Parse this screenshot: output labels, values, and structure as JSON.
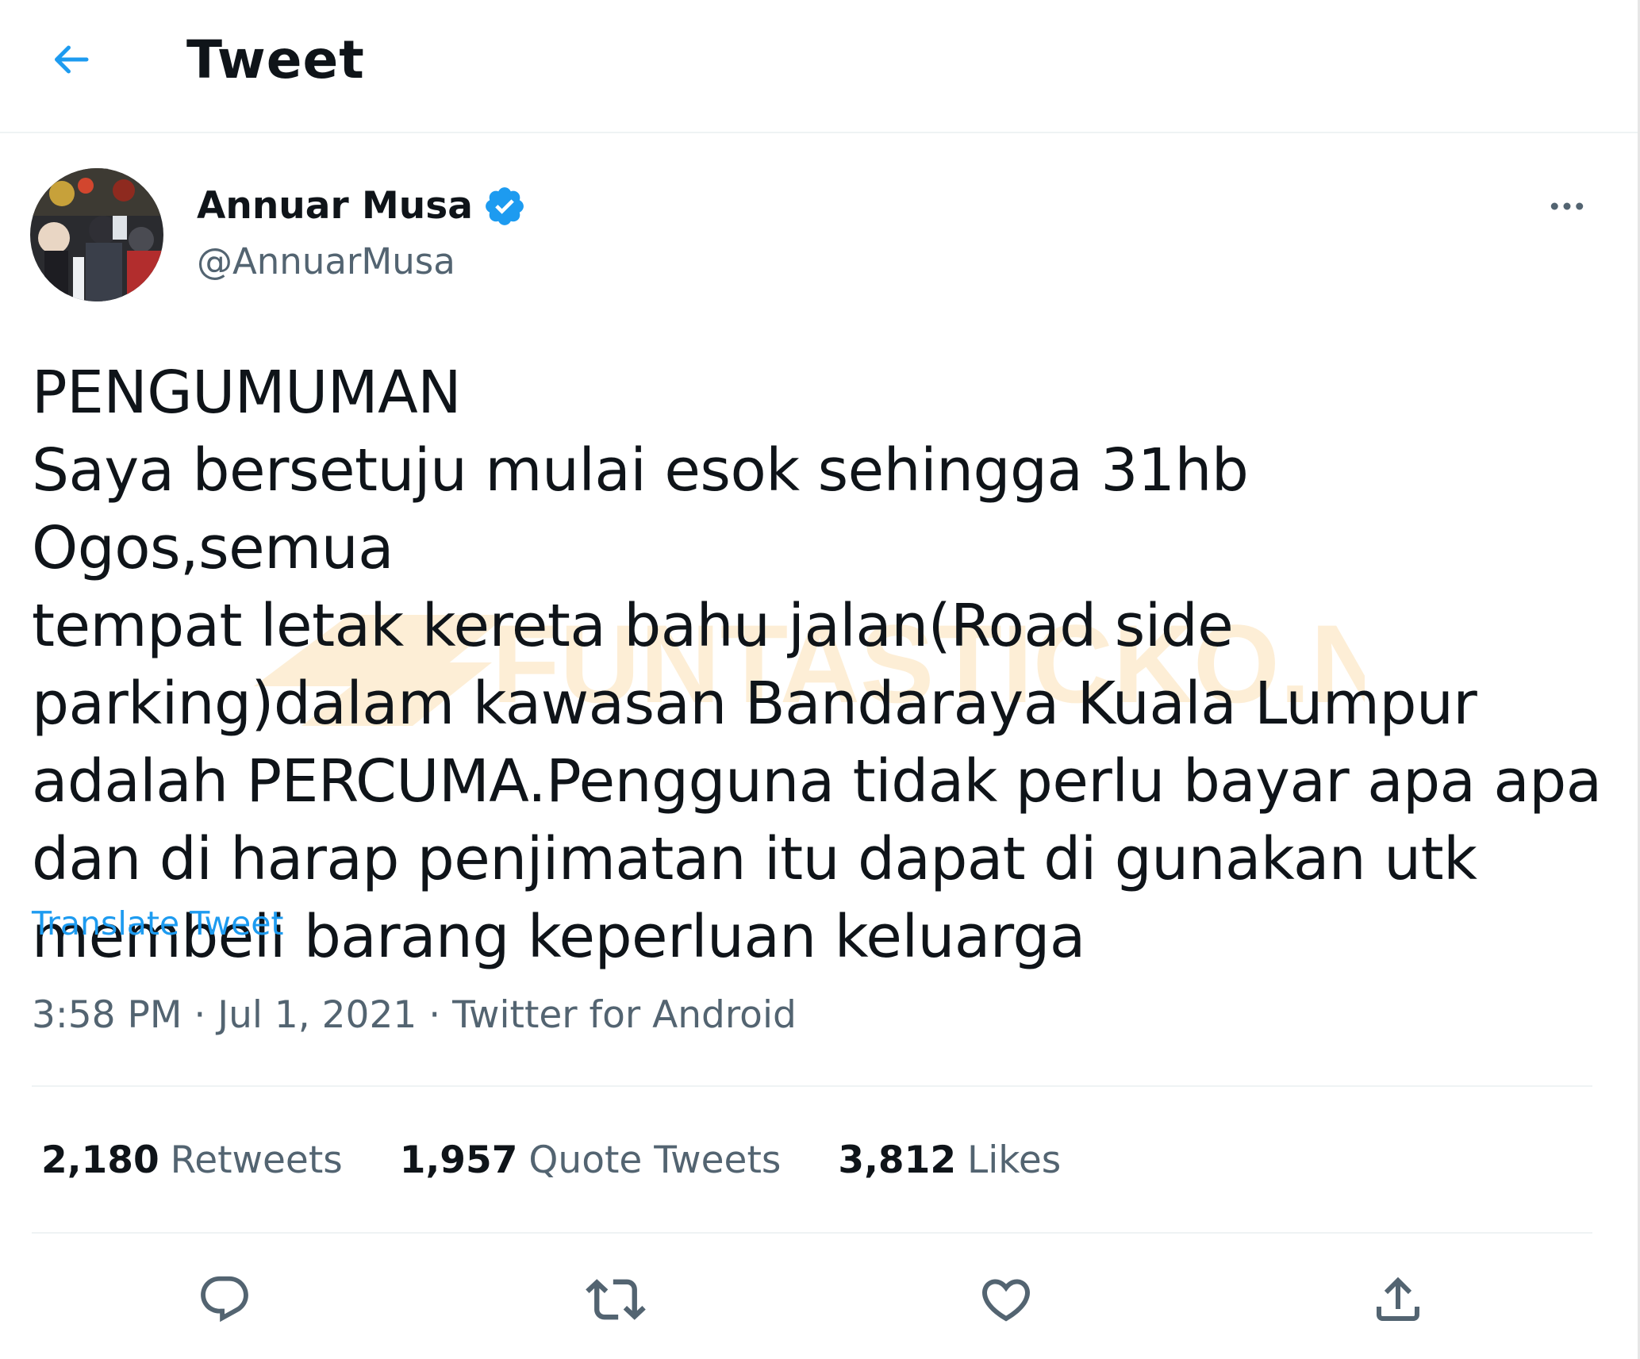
{
  "header": {
    "title": "Tweet",
    "back_icon": "arrow-left-icon"
  },
  "author": {
    "name": "Annuar Musa",
    "handle": "@AnnuarMusa",
    "verified": true,
    "avatar_icon": "avatar-photo"
  },
  "tweet": {
    "text": "PENGUMUMAN\nSaya bersetuju mulai esok sehingga 31hb Ogos,semua\ntempat letak kereta bahu jalan(Road side\nparking)dalam kawasan Bandaraya Kuala Lumpur\nadalah PERCUMA.Pengguna tidak perlu bayar apa apa\ndan di harap penjimatan itu dapat di gunakan utk\nmembeli barang keperluan keluarga",
    "translate_label": "Translate Tweet",
    "time": "3:58 PM",
    "separator": " · ",
    "date": "Jul 1, 2021",
    "source": "Twitter for Android"
  },
  "stats": {
    "retweets_count": "2,180",
    "retweets_label": "Retweets",
    "quotes_count": "1,957",
    "quotes_label": "Quote Tweets",
    "likes_count": "3,812",
    "likes_label": "Likes"
  },
  "actions": {
    "reply_icon": "reply-icon",
    "retweet_icon": "retweet-icon",
    "like_icon": "heart-icon",
    "share_icon": "share-icon"
  },
  "watermark": {
    "text": "FUNTASTICKO.NET"
  },
  "colors": {
    "accent": "#1d9bf0",
    "text_primary": "#0f1419",
    "text_secondary": "#536471",
    "divider": "#eff3f4",
    "watermark": "#f5a623"
  }
}
